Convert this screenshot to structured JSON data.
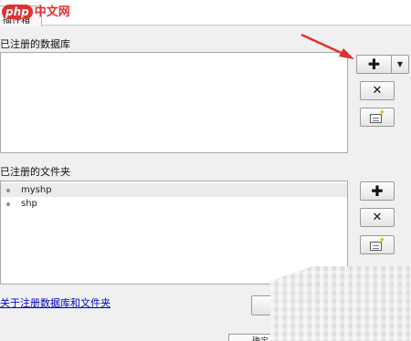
{
  "tab": {
    "label": "插件箱"
  },
  "watermark": {
    "php": "php",
    "site": "中文网"
  },
  "databases": {
    "label": "已注册的数据库",
    "items": []
  },
  "folders": {
    "label": "已注册的文件夹",
    "items": [
      "myshp",
      "shp"
    ]
  },
  "buttons": {
    "add_glyph": "✚",
    "remove_glyph": "✕",
    "dropdown_glyph": "▼"
  },
  "footer": {
    "help_link": "关于注册数据库和文件夹",
    "ok_label": "确定"
  },
  "colors": {
    "annotation_arrow": "#e0312e",
    "link": "#0000cc"
  }
}
